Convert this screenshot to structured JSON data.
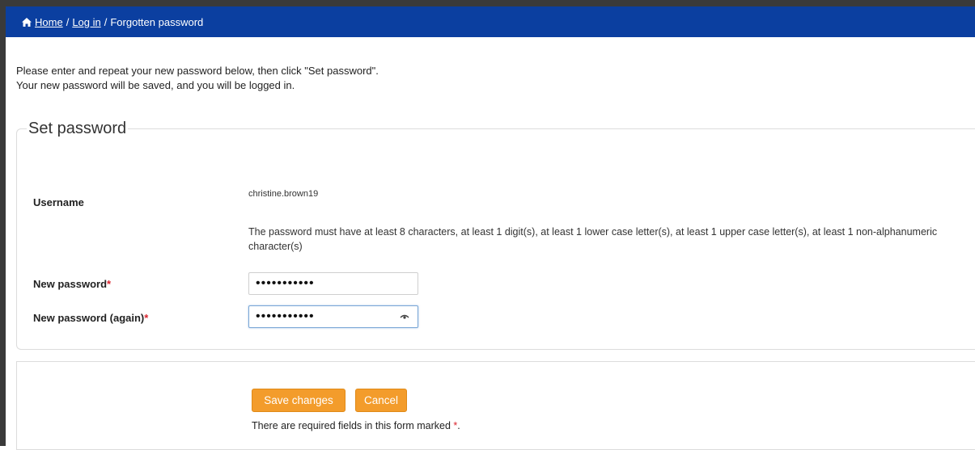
{
  "breadcrumb": {
    "items": [
      "Home",
      "Log in",
      "Forgotten password"
    ],
    "separator": "/"
  },
  "intro": {
    "line1": "Please enter and repeat your new password below, then click \"Set password\".",
    "line2": "Your new password will be saved, and you will be logged in."
  },
  "form": {
    "legend": "Set password",
    "username_label": "Username",
    "username_value": "christine.brown19",
    "password_rules": "The password must have at least 8 characters, at least 1 digit(s), at least 1 lower case letter(s), at least 1 upper case letter(s), at least 1 non-alphanumeric character(s)",
    "new_password_label": "New password",
    "new_password_value": "•••••••••••",
    "new_password_again_label": "New password (again)",
    "new_password_again_value": "•••••••••••",
    "required_marker": "*"
  },
  "actions": {
    "save_label": "Save changes",
    "cancel_label": "Cancel",
    "required_note": "There are required fields in this form marked",
    "required_note_end": "."
  },
  "colors": {
    "topbar": "#0b3fa0",
    "button": "#f39c2b",
    "required": "#d9232d"
  }
}
